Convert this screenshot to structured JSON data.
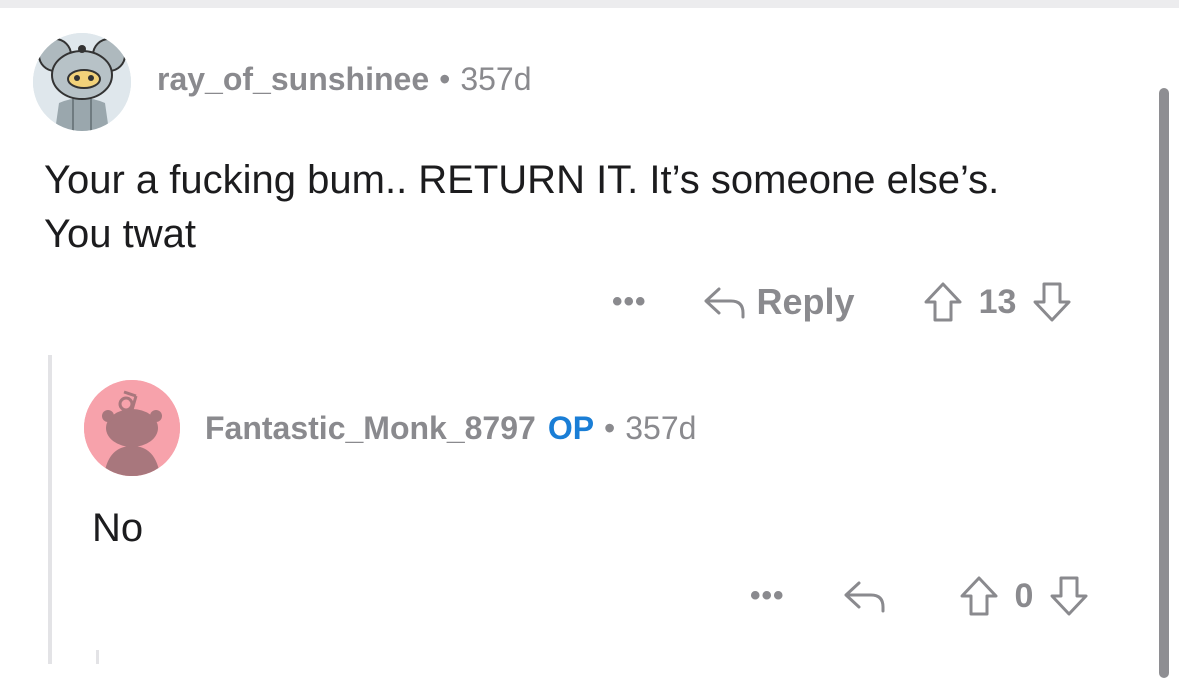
{
  "comment": {
    "username": "ray_of_sunshinee",
    "separator": "•",
    "age": "357d",
    "body_line1": "Your a fucking bum.. RETURN IT. It’s someone else’s.",
    "body_line2": "You twat",
    "more_label": "•••",
    "reply_label": "Reply",
    "score": "13",
    "avatar_icon": "koala-snoo-avatar-icon"
  },
  "reply": {
    "username": "Fantastic_Monk_8797",
    "op_badge": "OP",
    "separator": "•",
    "age": "357d",
    "body": "No",
    "more_label": "•••",
    "score": "0",
    "avatar_icon": "default-snoo-avatar-icon"
  },
  "colors": {
    "meta_gray": "#8a8a8e",
    "op_blue": "#1a7ed6",
    "text": "#1c1c1e",
    "avatar_pink": "#f7a2ab"
  }
}
